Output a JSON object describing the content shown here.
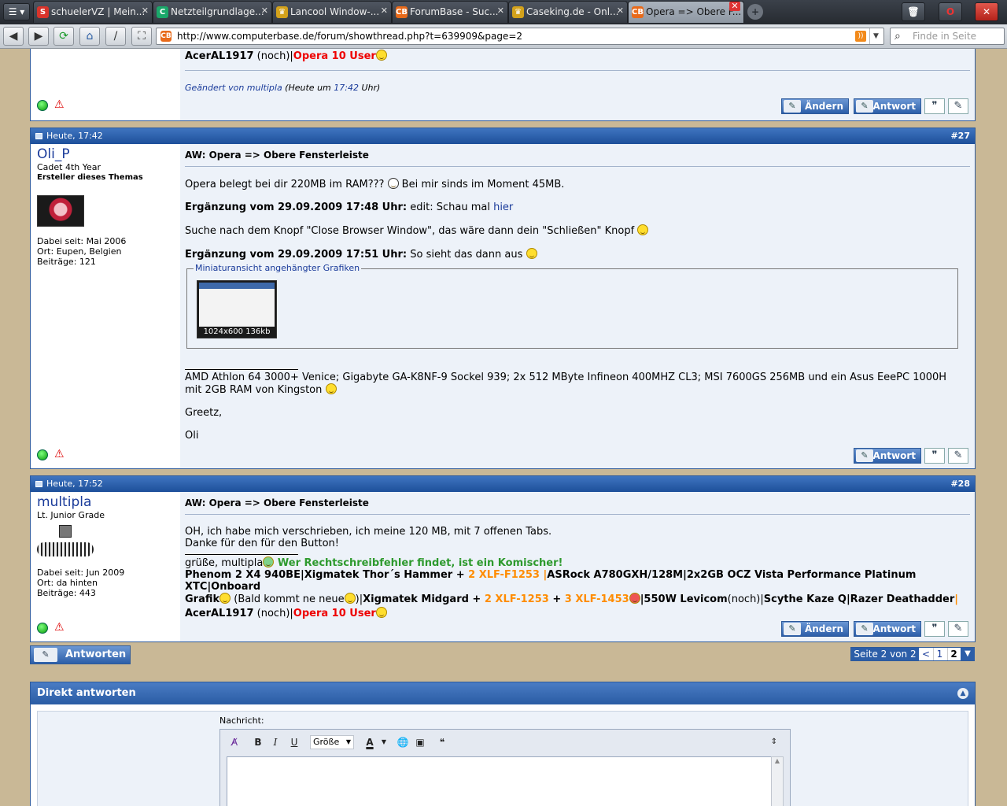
{
  "browser": {
    "menu_label": "☰",
    "tabs": [
      {
        "title": "schuelerVZ | Mein...",
        "fav": "S",
        "fav_color": "#d9342b",
        "active": false
      },
      {
        "title": "Netzteilgrundlage...",
        "fav": "C",
        "fav_color": "#1aa86a",
        "active": false
      },
      {
        "title": "Lancool Window-...",
        "fav": "♛",
        "fav_color": "#d4a21b",
        "active": false
      },
      {
        "title": "ForumBase - Suc...",
        "fav": "CB",
        "fav_color": "#e86a1a",
        "active": false
      },
      {
        "title": "Caseking.de - Onl...",
        "fav": "♛",
        "fav_color": "#d4a21b",
        "active": false
      },
      {
        "title": "Opera => Obere F...",
        "fav": "CB",
        "fav_color": "#e86a1a",
        "active": true
      }
    ],
    "url": "http://www.computerbase.de/forum/showthread.php?t=639909&page=2",
    "search_placeholder": "Finde in Seite"
  },
  "top_post": {
    "sig_acer": "AcerAL1917",
    "sig_noch": " (noch)|",
    "sig_opera": "Opera 10 User",
    "edited_by": "Geändert von multipla",
    "edited_when_prefix": " (Heute um ",
    "edited_time": "17:42",
    "edited_suffix": " Uhr)",
    "btn_edit": "Ändern",
    "btn_reply": "Antwort"
  },
  "post27": {
    "date": "Heute, 17:42",
    "number": "#27",
    "username": "Oli_P",
    "usertitle": "Cadet 4th Year",
    "creator": "Ersteller dieses Themas",
    "joined": "Dabei seit: Mai 2006",
    "location": "Ort: Eupen, Belgien",
    "posts": "Beiträge: 121",
    "title": "AW: Opera => Obere Fensterleiste",
    "line1a": "Opera belegt bei dir 220MB im RAM??? ",
    "line1b": " Bei mir sinds im Moment 45MB.",
    "add1_label": "Ergänzung vom 29.09.2009 17:48 Uhr:",
    "add1_text": " edit: Schau mal ",
    "add1_link": "hier",
    "line2": "Suche nach dem Knopf \"Close Browser Window\", das wäre dann dein \"Schließen\" Knopf ",
    "add2_label": "Ergänzung vom 29.09.2009 17:51 Uhr:",
    "add2_text": " So sieht das dann aus ",
    "attach_legend": "Miniaturansicht angehängter Grafiken",
    "attach_caption": "1024x600  136kb",
    "signature": "AMD Athlon 64 3000+ Venice; Gigabyte GA-K8NF-9 Sockel 939; 2x 512 MByte Infineon 400MHZ CL3; MSI 7600GS 256MB und ein Asus EeePC 1000H mit 2GB RAM von Kingston ",
    "greetz": "Greetz,",
    "name": "Oli",
    "btn_reply": "Antwort"
  },
  "post28": {
    "date": "Heute, 17:52",
    "number": "#28",
    "username": "multipla",
    "usertitle": "Lt. Junior Grade",
    "joined": "Dabei seit: Jun 2009",
    "location": "Ort: da hinten",
    "posts": "Beiträge: 443",
    "title": "AW: Opera => Obere Fensterleiste",
    "text1": "OH, ich habe mich verschrieben, ich meine 120 MB, mit 7 offenen Tabs.",
    "text2": "Danke für den für den Button!",
    "greet": "grüße, multipla",
    "sig_green": " Wer Rechtschreibfehler findet, ist ein Komischer!",
    "sig_l1_a": "Phenom 2 X4 940BE",
    "sig_l1_b": "|Xigmatek Thor´s Hammer + ",
    "sig_l1_c": "2 XLF-F1253",
    "sig_l1_d": " |",
    "sig_l1_e": "ASRock A780GXH/128M",
    "sig_l1_f": "|2x2GB OCZ Vista Performance Platinum XTC",
    "sig_l1_g": "|Onboard",
    "sig_l2_a": "Grafik",
    "sig_l2_b": " (Bald kommt ne neue",
    "sig_l2_c": ")|",
    "sig_l2_d": "Xigmatek Midgard + ",
    "sig_l2_e": "2 XLF-1253",
    "sig_l2_f": " + ",
    "sig_l2_g": "3 XLF-1453",
    "sig_l2_h": "|550W Levicom",
    "sig_l2_i": "(noch)|",
    "sig_l2_j": "Scythe Kaze Q",
    "sig_l2_k": "|Razer Deathadder",
    "sig_l2_l": "|",
    "sig_l3_a": "AcerAL1917",
    "sig_l3_b": " (noch)|",
    "sig_l3_c": "Opera 10 User",
    "btn_edit": "Ändern",
    "btn_reply": "Antwort"
  },
  "controls": {
    "answer_button": "Antworten",
    "pager_label": "Seite 2 von 2",
    "pager_prev": "<",
    "pager_p1": "1",
    "pager_p2": "2"
  },
  "reply": {
    "title": "Direkt antworten",
    "message_label": "Nachricht:",
    "size_label": "Größe"
  },
  "colors": {
    "accent": "#1d4f9a",
    "background": "#c9b896",
    "post_bg": "#edf2f9"
  }
}
